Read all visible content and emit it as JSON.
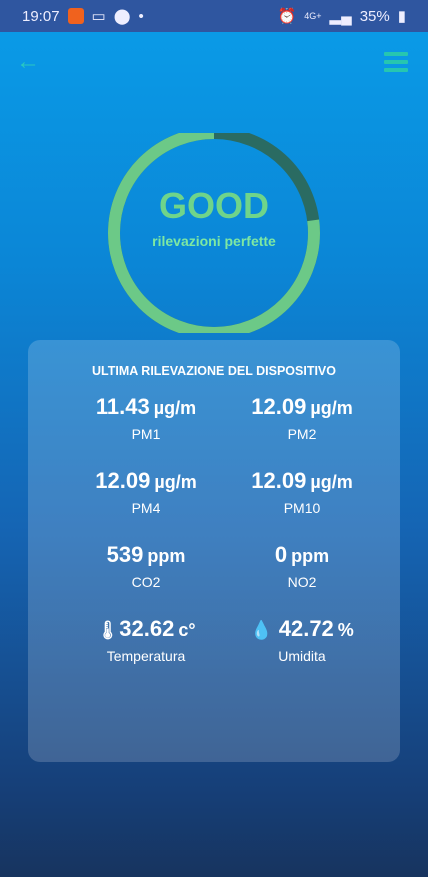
{
  "status_bar": {
    "time": "19:07",
    "network": "4G+",
    "battery": "35%"
  },
  "gauge": {
    "status": "GOOD",
    "subtitle": "rilevazioni perfette",
    "fraction": 0.77,
    "colors": {
      "fill": "#6cc987",
      "track": "#2a6b62"
    }
  },
  "card": {
    "title": "ULTIMA RILEVAZIONE DEL DISPOSITIVO",
    "readings": [
      {
        "value": "11.43",
        "unit": "µg/m",
        "label": "PM1"
      },
      {
        "value": "12.09",
        "unit": "µg/m",
        "label": "PM2"
      },
      {
        "value": "12.09",
        "unit": "µg/m",
        "label": "PM4"
      },
      {
        "value": "12.09",
        "unit": "µg/m",
        "label": "PM10"
      },
      {
        "value": "539",
        "unit": "ppm",
        "label": "CO2"
      },
      {
        "value": "0",
        "unit": "ppm",
        "label": "NO2"
      },
      {
        "value": "32.62",
        "unit": "c°",
        "label": "Temperatura",
        "icon": "thermometer-icon"
      },
      {
        "value": "42.72",
        "unit": "%",
        "label": "Umidita",
        "icon": "water-drop-icon"
      }
    ]
  }
}
